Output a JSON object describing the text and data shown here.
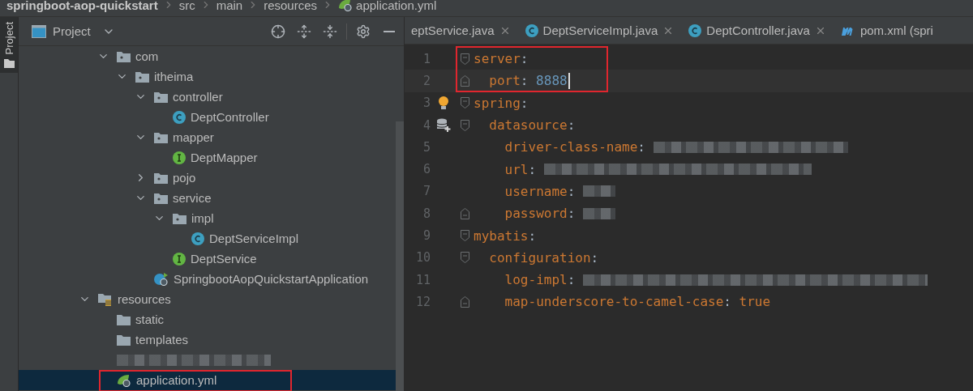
{
  "breadcrumb": [
    {
      "label": "springboot-aop-quickstart",
      "kind": "project"
    },
    {
      "label": "src",
      "kind": "folder"
    },
    {
      "label": "main",
      "kind": "folder"
    },
    {
      "label": "resources",
      "kind": "folder"
    },
    {
      "label": "application.yml",
      "kind": "spring-config"
    }
  ],
  "side_strip": {
    "label": "Project"
  },
  "project_panel": {
    "title": "Project",
    "tree": [
      {
        "kind": "offscreen",
        "children": [
          {
            "kind": "package",
            "label": "com",
            "expanded": true,
            "selected": false,
            "children": [
              {
                "kind": "package",
                "label": "itheima",
                "expanded": true,
                "selected": false,
                "children": [
                  {
                    "kind": "package",
                    "label": "controller",
                    "expanded": true,
                    "selected": false,
                    "children": [
                      {
                        "kind": "class",
                        "label": "DeptController",
                        "selected": false
                      }
                    ]
                  },
                  {
                    "kind": "package",
                    "label": "mapper",
                    "expanded": true,
                    "selected": false,
                    "children": [
                      {
                        "kind": "interface",
                        "label": "DeptMapper",
                        "selected": false
                      }
                    ]
                  },
                  {
                    "kind": "package",
                    "label": "pojo",
                    "expanded": false,
                    "selected": false
                  },
                  {
                    "kind": "package",
                    "label": "service",
                    "expanded": true,
                    "selected": false,
                    "children": [
                      {
                        "kind": "package",
                        "label": "impl",
                        "expanded": true,
                        "selected": false,
                        "children": [
                          {
                            "kind": "class",
                            "label": "DeptServiceImpl",
                            "selected": false
                          }
                        ]
                      },
                      {
                        "kind": "interface",
                        "label": "DeptService",
                        "selected": false
                      }
                    ]
                  },
                  {
                    "kind": "spring-app",
                    "label": "SpringbootAopQuickstartApplication",
                    "selected": false
                  }
                ]
              }
            ]
          }
        ]
      },
      {
        "kind": "resources",
        "label": "resources",
        "expanded": true,
        "selected": false,
        "children": [
          {
            "kind": "folder",
            "label": "static",
            "selected": false
          },
          {
            "kind": "folder",
            "label": "templates",
            "selected": false
          },
          {
            "kind": "redacted",
            "selected": false
          },
          {
            "kind": "spring-config",
            "label": "application.yml",
            "selected": true,
            "annotated": true
          }
        ]
      }
    ]
  },
  "editor": {
    "tabs": [
      {
        "label": "eptService.java",
        "kind": "none",
        "closable": true
      },
      {
        "label": "DeptServiceImpl.java",
        "kind": "class",
        "closable": true
      },
      {
        "label": "DeptController.java",
        "kind": "class",
        "closable": true
      },
      {
        "label": "pom.xml (spri",
        "kind": "maven",
        "closable": false
      }
    ],
    "lines": [
      {
        "number": "1",
        "key": "server",
        "sep": ":",
        "fold": {
          "kind": "start"
        },
        "annotated": true,
        "children": [
          {
            "number": "2",
            "key": "port",
            "sep": ":",
            "value": {
              "text": "8888",
              "kind": "number"
            },
            "fold": {
              "kind": "end"
            },
            "annotated": true,
            "current": true
          }
        ]
      },
      {
        "number": "3",
        "key": "spring",
        "sep": ":",
        "fold": {
          "kind": "start"
        },
        "gutter": {
          "kind": "bulb"
        },
        "children": [
          {
            "number": "4",
            "key": "datasource",
            "sep": ":",
            "fold": {
              "kind": "start"
            },
            "gutter": {
              "kind": "database"
            },
            "children": [
              {
                "number": "5",
                "key": "driver-class-name",
                "sep": ":",
                "redacted": {
                  "kind": "long"
                }
              },
              {
                "number": "6",
                "key": "url",
                "sep": ":",
                "redacted": {
                  "kind": "xlong"
                }
              },
              {
                "number": "7",
                "key": "username",
                "sep": ":",
                "redacted": {
                  "kind": "short"
                }
              },
              {
                "number": "8",
                "key": "password",
                "sep": ":",
                "redacted": {
                  "kind": "short"
                },
                "fold": {
                  "kind": "end"
                }
              }
            ]
          }
        ]
      },
      {
        "number": "9",
        "key": "mybatis",
        "sep": ":",
        "fold": {
          "kind": "start"
        },
        "children": [
          {
            "number": "10",
            "key": "configuration",
            "sep": ":",
            "fold": {
              "kind": "start"
            },
            "children": [
              {
                "number": "11",
                "key": "log-impl",
                "sep": ":",
                "redacted": {
                  "kind": "xxlong"
                }
              },
              {
                "number": "12",
                "key": "map-underscore-to-camel-case",
                "sep": ":",
                "value": {
                  "text": "true",
                  "kind": "keyword"
                },
                "fold": {
                  "kind": "end"
                }
              }
            ]
          }
        ]
      }
    ]
  }
}
